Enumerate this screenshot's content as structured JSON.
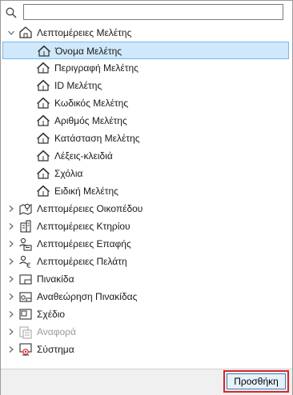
{
  "search": {
    "value": "",
    "placeholder": ""
  },
  "tree": {
    "items": [
      {
        "label": "Λεπτομέρειες Μελέτης",
        "icon": "house-folder-icon",
        "expanded": true,
        "level": 0
      },
      {
        "label": "Όνομα Μελέτης",
        "icon": "house-icon",
        "level": 1,
        "selected": true
      },
      {
        "label": "Περιγραφή Μελέτης",
        "icon": "house-icon",
        "level": 1
      },
      {
        "label": "ID Μελέτης",
        "icon": "house-icon",
        "level": 1
      },
      {
        "label": "Κωδικός Μελέτης",
        "icon": "house-icon",
        "level": 1
      },
      {
        "label": "Αριθμός Μελέτης",
        "icon": "house-icon",
        "level": 1
      },
      {
        "label": "Κατάσταση Μελέτης",
        "icon": "house-icon",
        "level": 1
      },
      {
        "label": "Λέξεις-κλειδιά",
        "icon": "house-icon",
        "level": 1
      },
      {
        "label": "Σχόλια",
        "icon": "house-icon",
        "level": 1
      },
      {
        "label": "Ειδική Μελέτης",
        "icon": "house-icon",
        "level": 1
      },
      {
        "label": "Λεπτομέρειες Οικοπέδου",
        "icon": "map-pin-icon",
        "level": 0
      },
      {
        "label": "Λεπτομέρειες Κτηρίου",
        "icon": "building-icon",
        "level": 0
      },
      {
        "label": "Λεπτομέρειες Επαφής",
        "icon": "contact-icon",
        "level": 0
      },
      {
        "label": "Λεπτομέρειες Πελάτη",
        "icon": "client-icon",
        "level": 0
      },
      {
        "label": "Πινακίδα",
        "icon": "title-block-icon",
        "level": 0
      },
      {
        "label": "Αναθεώρηση Πινακίδας",
        "icon": "title-block-revision-icon",
        "level": 0
      },
      {
        "label": "Σχέδιο",
        "icon": "drawing-icon",
        "level": 0
      },
      {
        "label": "Αναφορά",
        "icon": "reference-icon",
        "level": 0,
        "disabled": true
      },
      {
        "label": "Σύστημα",
        "icon": "system-icon",
        "level": 0
      }
    ]
  },
  "footer": {
    "add_label": "Προσθήκη"
  },
  "colors": {
    "selection_bg": "#cfe8fb",
    "selection_border": "#7ab8e8",
    "highlight": "#d9232d"
  }
}
